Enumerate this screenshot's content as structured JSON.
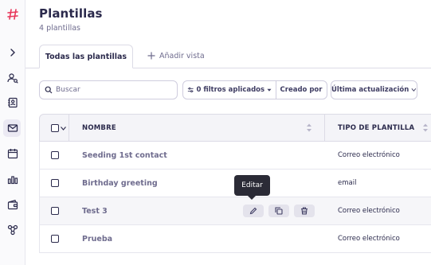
{
  "sidebar": {
    "icons": [
      "logo-hash-icon",
      "chevron-right-icon",
      "user-search-icon",
      "contacts-book-icon",
      "mail-icon",
      "calendar-icon",
      "bar-chart-icon",
      "wallet-icon",
      "workflow-icon"
    ],
    "active_item": "mail-icon",
    "brand_color": "#e8375a"
  },
  "header": {
    "title": "Plantillas",
    "subtitle": "4 plantillas"
  },
  "tabs": {
    "active_label": "Todas las plantillas",
    "add_label": "Añadir vista"
  },
  "filters": {
    "search_placeholder": "Buscar",
    "applied_label": "0 filtros aplicados",
    "created_by_label": "Creado por",
    "updated_label": "Última actualización"
  },
  "table": {
    "columns": {
      "name": "NOMBRE",
      "type": "TIPO DE PLANTILLA"
    },
    "rows": [
      {
        "name": "Seeding 1st contact",
        "type": "Correo electrónico"
      },
      {
        "name": "Birthday greeting",
        "type": "email"
      },
      {
        "name": "Test 3",
        "type": "Correo electrónico"
      },
      {
        "name": "Prueba",
        "type": "Correo electrónico"
      }
    ],
    "hovered_row": 2
  },
  "tooltip": {
    "text": "Editar"
  }
}
